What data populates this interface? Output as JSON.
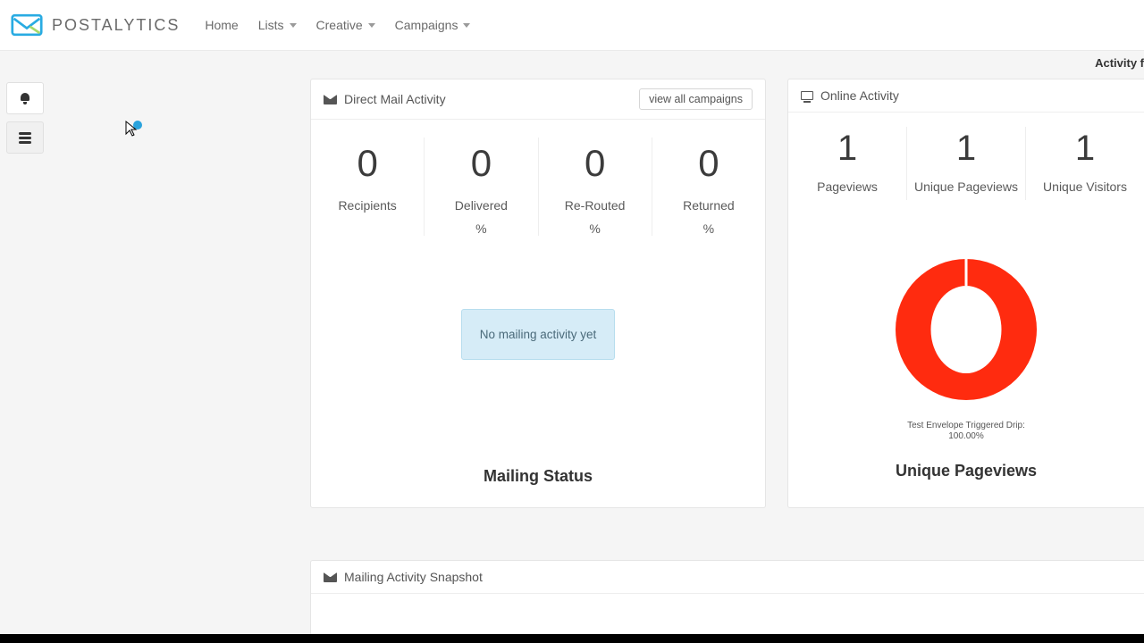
{
  "brand": {
    "name": "POSTALYTICS"
  },
  "nav": {
    "home": "Home",
    "lists": "Lists",
    "creative": "Creative",
    "campaigns": "Campaigns"
  },
  "activity_banner": "Activity f",
  "direct_mail": {
    "title": "Direct Mail Activity",
    "view_all": "view all campaigns",
    "stats": {
      "recipients": {
        "value": "0",
        "label": "Recipients"
      },
      "delivered": {
        "value": "0",
        "label": "Delivered",
        "pct": "%"
      },
      "rerouted": {
        "value": "0",
        "label": "Re-Routed",
        "pct": "%"
      },
      "returned": {
        "value": "0",
        "label": "Returned",
        "pct": "%"
      }
    },
    "no_activity": "No mailing activity yet",
    "status_title": "Mailing Status"
  },
  "online": {
    "title": "Online Activity",
    "stats": {
      "pageviews": {
        "value": "1",
        "label": "Pageviews"
      },
      "unique_pageviews": {
        "value": "1",
        "label": "Unique Pageviews"
      },
      "unique_visitors": {
        "value": "1",
        "label": "Unique Visitors"
      }
    },
    "donut_legend": "Test Envelope Triggered Drip:",
    "donut_value": "100.00%",
    "donut_title": "Unique Pageviews"
  },
  "snapshot": {
    "title": "Mailing Activity Snapshot"
  },
  "chart_data": [
    {
      "type": "pie",
      "title": "Unique Pageviews",
      "series": [
        {
          "name": "Test Envelope Triggered Drip",
          "value": 100.0
        }
      ],
      "unit": "%"
    }
  ]
}
